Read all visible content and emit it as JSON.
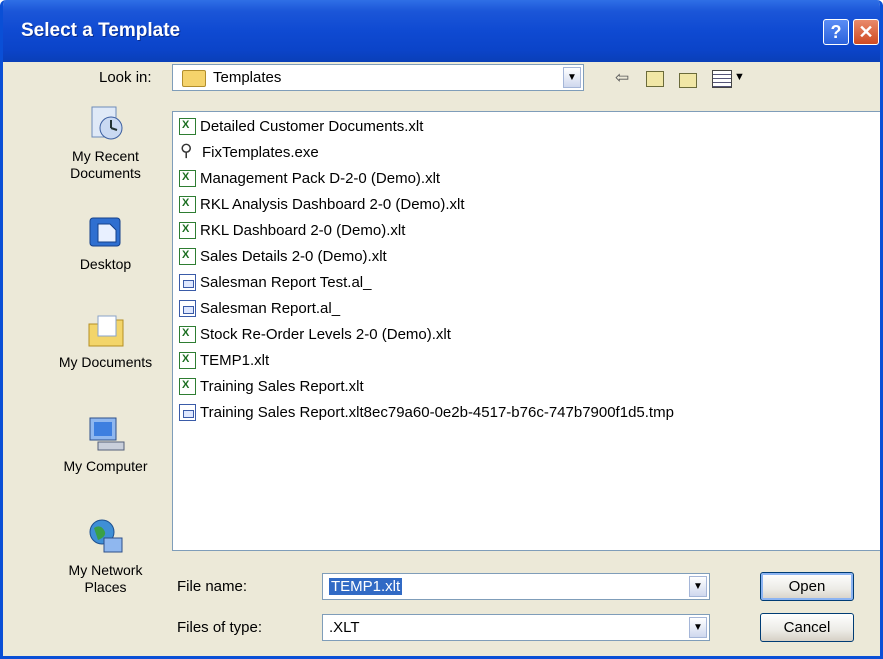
{
  "window": {
    "title": "Select a Template",
    "help_glyph": "?",
    "close_glyph": "✕"
  },
  "lookin": {
    "label": "Look in:",
    "value": "Templates"
  },
  "toolbar": {
    "back_icon": "back-arrow-icon",
    "up_icon": "up-folder-icon",
    "new_folder_icon": "new-folder-icon",
    "views_icon": "views-menu-icon"
  },
  "places": [
    {
      "label": "My Recent Documents",
      "icon": "recent-documents-icon"
    },
    {
      "label": "Desktop",
      "icon": "desktop-icon"
    },
    {
      "label": "My Documents",
      "icon": "my-documents-icon"
    },
    {
      "label": "My Computer",
      "icon": "my-computer-icon"
    },
    {
      "label": "My Network Places",
      "icon": "network-places-icon"
    }
  ],
  "files": [
    {
      "name": "Detailed Customer Documents.xlt",
      "type": "xlt"
    },
    {
      "name": "FixTemplates.exe",
      "type": "exe"
    },
    {
      "name": "Management Pack D-2-0 (Demo).xlt",
      "type": "xlt"
    },
    {
      "name": "RKL Analysis Dashboard 2-0 (Demo).xlt",
      "type": "xlt"
    },
    {
      "name": "RKL Dashboard 2-0 (Demo).xlt",
      "type": "xlt"
    },
    {
      "name": "Sales Details 2-0 (Demo).xlt",
      "type": "xlt"
    },
    {
      "name": "Salesman Report Test.al_",
      "type": "al"
    },
    {
      "name": "Salesman Report.al_",
      "type": "al"
    },
    {
      "name": "Stock Re-Order Levels 2-0 (Demo).xlt",
      "type": "xlt"
    },
    {
      "name": "TEMP1.xlt",
      "type": "xlt"
    },
    {
      "name": "Training Sales Report.xlt",
      "type": "xlt"
    },
    {
      "name": "Training Sales Report.xlt8ec79a60-0e2b-4517-b76c-747b7900f1d5.tmp",
      "type": "al"
    }
  ],
  "filename": {
    "label": "File name:",
    "value": "TEMP1.xlt"
  },
  "filetype": {
    "label": "Files of type:",
    "value": ".XLT"
  },
  "buttons": {
    "open": "Open",
    "cancel": "Cancel"
  },
  "colors": {
    "titlebar": "#0b44c9",
    "dialog_bg": "#ece9d8",
    "selection": "#316ac5"
  }
}
